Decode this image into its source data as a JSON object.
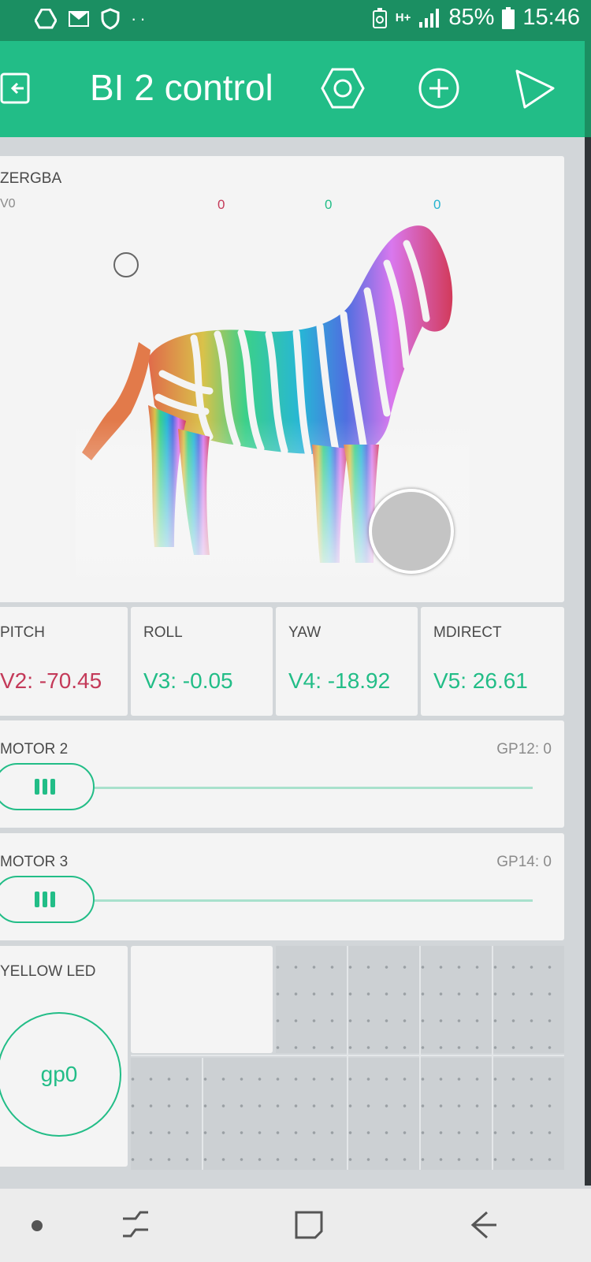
{
  "status_bar": {
    "left_icons": [
      "drive-icon",
      "gmail-icon",
      "shield-icon",
      "more-notifications-icon"
    ],
    "network": "H+",
    "battery_percent": "85%",
    "time": "15:46"
  },
  "app_bar": {
    "title": "BI 2 control",
    "icons": [
      "exit-icon",
      "settings-hex-icon",
      "add-circle-icon",
      "play-icon"
    ]
  },
  "zergba": {
    "label": "ZERGBA",
    "pin": "V0",
    "r_value": "0",
    "g_value": "0",
    "b_value": "0",
    "colors": {
      "r": "#c43a59",
      "g": "#22bd87",
      "b": "#26b3cf"
    }
  },
  "displays": [
    {
      "label": "PITCH",
      "value": "V2: -70.45",
      "color": "#c43a59"
    },
    {
      "label": "ROLL",
      "value": "V3: -0.05",
      "color": "#22bd87"
    },
    {
      "label": "YAW",
      "value": "V4: -18.92",
      "color": "#22bd87"
    },
    {
      "label": "MDIRECT",
      "value": "V5: 26.61",
      "color": "#22bd87"
    }
  ],
  "sliders": [
    {
      "label": "MOTOR 2",
      "pin_value": "GP12: 0",
      "value": 0
    },
    {
      "label": "MOTOR 3",
      "pin_value": "GP14: 0",
      "value": 0
    }
  ],
  "button": {
    "label": "YELLOW LED",
    "text": "gp0"
  },
  "colors": {
    "accent": "#22bd87",
    "status_bar": "#1b8f62",
    "widget_bg": "#f4f4f4",
    "canvas_bg": "#d2d6d9"
  },
  "nav_bar": {
    "icons": [
      "dot-icon",
      "recent-apps-icon",
      "home-icon",
      "back-icon"
    ]
  }
}
